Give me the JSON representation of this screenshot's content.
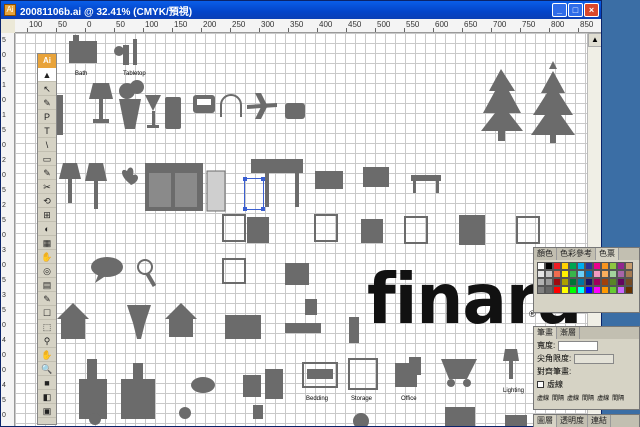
{
  "window": {
    "title": "20081106b.ai @ 32.41% (CMYK/預視)",
    "icon": "Ai",
    "buttons": [
      "_",
      "□",
      "×"
    ]
  },
  "ruler": {
    "top": [
      "100",
      "50",
      "0",
      "50",
      "100",
      "150",
      "200",
      "250",
      "300",
      "350",
      "400",
      "450",
      "500",
      "550",
      "600",
      "650",
      "700",
      "750",
      "800",
      "850"
    ],
    "left": [
      "5",
      "0",
      "5",
      "1",
      "0",
      "1",
      "5",
      "0",
      "2",
      "0",
      "5",
      "2",
      "5",
      "0",
      "3",
      "0",
      "5",
      "3",
      "5",
      "0",
      "4",
      "0",
      "0",
      "4",
      "5",
      "0"
    ]
  },
  "toolbox": {
    "logo": "Ai",
    "tools": [
      "▲",
      "↖",
      "✎",
      "P",
      "T",
      "\\",
      "▭",
      "✎",
      "✂",
      "⟲",
      "⊞",
      "◐",
      "▦",
      "✋",
      "◎",
      "▤",
      "✎",
      "☐",
      "⬚",
      "⚲",
      "✋",
      "🔍",
      "■",
      "◧",
      "▣"
    ]
  },
  "canvas": {
    "labels": {
      "bath": "Bath",
      "tabletop": "Tabletop",
      "lighting": "Lighting",
      "bedding": "Bedding",
      "storage": "Storage",
      "office": "Office"
    },
    "logo": "finara",
    "logo_mark": "®"
  },
  "color_panel": {
    "tabs": [
      "顏色",
      "色彩參考",
      "色票"
    ],
    "swatches": [
      "#ffffff",
      "#000000",
      "#ed1c24",
      "#ffd200",
      "#00a651",
      "#00aeef",
      "#2e3192",
      "#ec008c",
      "#f7941d",
      "#8dc63f",
      "#92278f",
      "#c69c6d",
      "#e6e6e6",
      "#c8c8c8",
      "#f26c4f",
      "#fff200",
      "#39b54a",
      "#6dcff6",
      "#0072bc",
      "#f49ac1",
      "#fbaf5d",
      "#a3d39c",
      "#a864a8",
      "#a67c52",
      "#b3b3b3",
      "#999999",
      "#9e0b0f",
      "#aba000",
      "#007236",
      "#0076a3",
      "#1b1464",
      "#9e005d",
      "#a0410d",
      "#598527",
      "#630460",
      "#754c24",
      "#808080",
      "#666666",
      "#ff0000",
      "#ffff00",
      "#00ff00",
      "#00ffff",
      "#0000ff",
      "#ff00ff",
      "#ff9900",
      "#66cc33",
      "#cc66ff",
      "#663300"
    ]
  },
  "stroke_panel": {
    "tabs": [
      "筆畫",
      "漸層"
    ],
    "weight_label": "寬度:",
    "miter_label": "尖角限度:",
    "align_label": "對齊筆畫:",
    "dashed_label": "虛線",
    "dash_labels": [
      "虛線",
      "間隔",
      "虛線",
      "間隔",
      "虛線",
      "間隔"
    ]
  },
  "bottom_panel": {
    "tabs": [
      "圖層",
      "透明度",
      "連結"
    ]
  }
}
